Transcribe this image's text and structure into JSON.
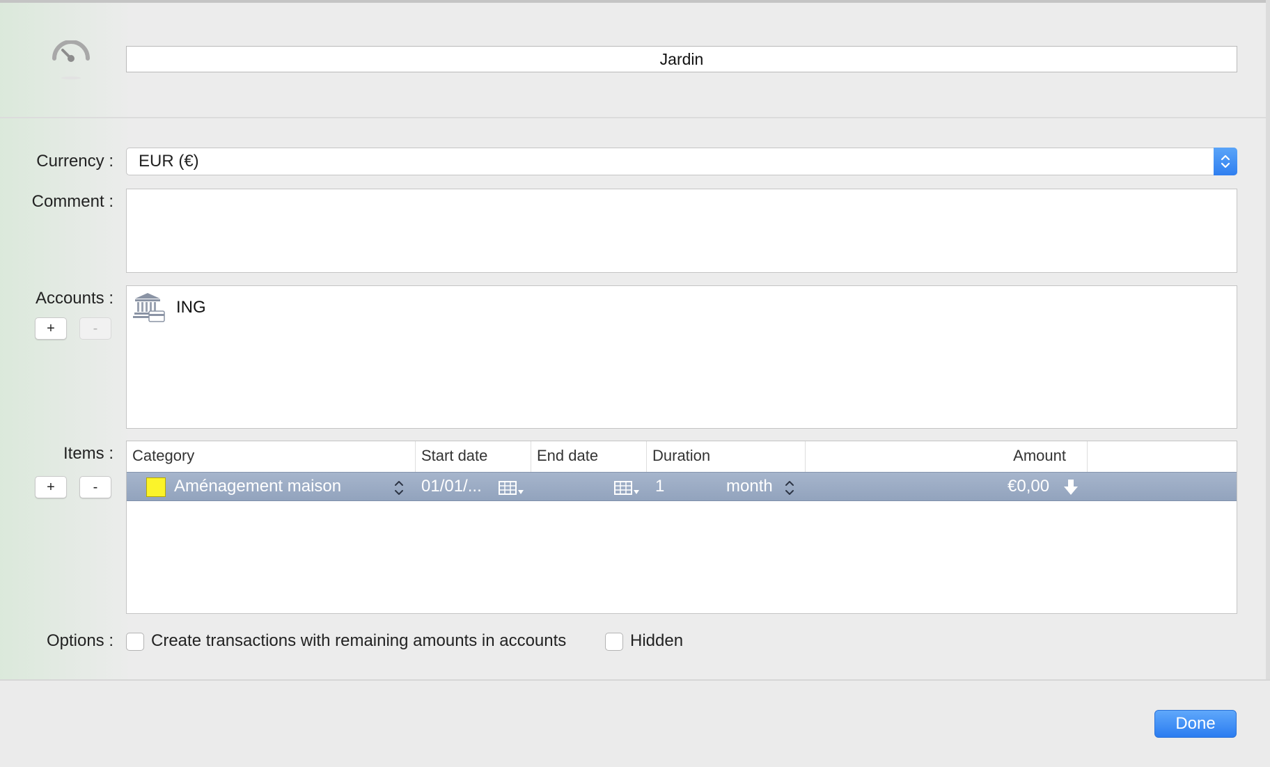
{
  "header": {
    "name_value": "Jardin",
    "icon": "gauge-icon"
  },
  "labels": {
    "currency": "Currency :",
    "comment": "Comment :",
    "accounts": "Accounts :",
    "items": "Items :",
    "options": "Options :"
  },
  "currency": {
    "selected": "EUR (€)"
  },
  "comment": {
    "value": ""
  },
  "accounts": {
    "add_label": "+",
    "remove_label": "-",
    "list": [
      {
        "name": "ING",
        "icon": "bank-icon"
      }
    ]
  },
  "items": {
    "add_label": "+",
    "remove_label": "-",
    "columns": [
      "Category",
      "Start date",
      "End date",
      "Duration",
      "Amount"
    ],
    "rows": [
      {
        "category": "Aménagement maison",
        "color": "#fbf32a",
        "start_date": "01/01/...",
        "end_date": "",
        "duration": "1",
        "duration_unit": "month",
        "amount": "€0,00"
      }
    ]
  },
  "options": {
    "remaining_label": "Create transactions with remaining amounts in accounts",
    "remaining_checked": false,
    "hidden_label": "Hidden",
    "hidden_checked": false
  },
  "footer": {
    "done_label": "Done"
  },
  "colors": {
    "accent": "#2f7ff0",
    "selection": "#9aaac3",
    "swatch": "#fbf32a"
  }
}
